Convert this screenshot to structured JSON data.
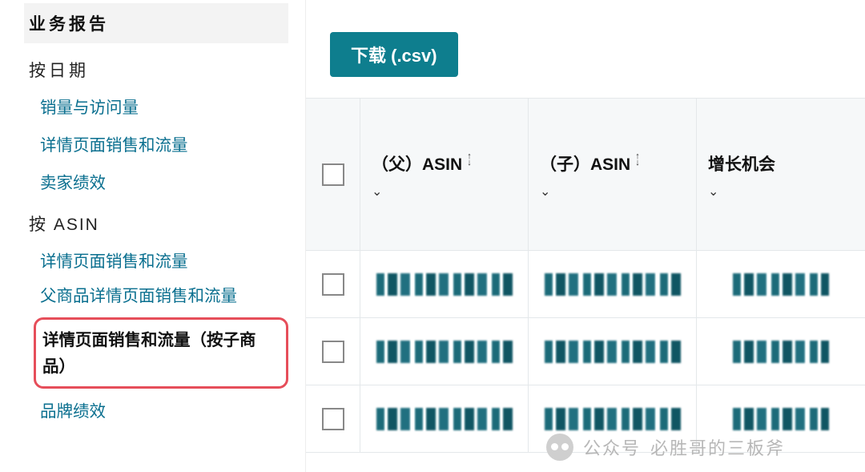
{
  "sidebar": {
    "section_title": "业务报告",
    "by_date_label": "按日期",
    "by_asin_label": "按 ASIN",
    "date_items": [
      "销量与访问量",
      "详情页面销售和流量",
      "卖家绩效"
    ],
    "asin_items": [
      "详情页面销售和流量",
      "父商品详情页面销售和流量"
    ],
    "asin_highlighted": "详情页面销售和流量（按子商品）",
    "asin_after": "品牌绩效"
  },
  "toolbar": {
    "download_label": "下载 (.csv)"
  },
  "table": {
    "columns": {
      "parent_asin": "（父）ASIN",
      "child_asin": "（子）ASIN",
      "growth": "增长机会"
    },
    "row_count": 3
  },
  "icons": {
    "sort_up": "↑",
    "sort_down": "↓",
    "chevron_down": "⌄"
  },
  "watermark": {
    "prefix": "公众号",
    "name": "必胜哥的三板斧"
  }
}
